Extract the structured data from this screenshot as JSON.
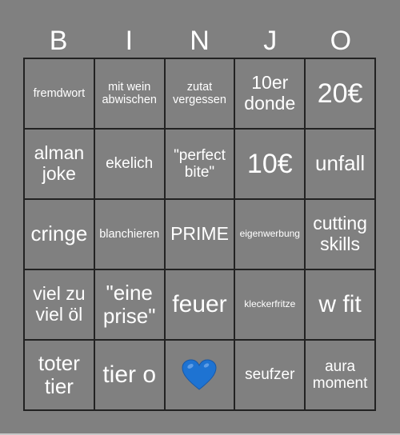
{
  "title_letters": [
    "B",
    "I",
    "N",
    "J",
    "O"
  ],
  "free_space": {
    "icon": "blue-heart-icon",
    "color": "#1e73d2"
  },
  "rows": [
    [
      "fremdwort",
      "mit wein\nabwischen",
      "zutat\nvergessen",
      "10er\ndonde",
      "20€"
    ],
    [
      "alman\njoke",
      "ekelich",
      "\"perfect\nbite\"",
      "10€",
      "unfall"
    ],
    [
      "cringe",
      "blanchieren",
      "PRIME",
      "eigenwerbung",
      "cutting\nskills"
    ],
    [
      "viel zu\nviel öl",
      "\"eine\nprise\"",
      "feuer",
      "kleckerfritze",
      "w fit"
    ],
    [
      "toter\ntier",
      "tier o",
      "",
      "seufzer",
      "aura\nmoment"
    ]
  ]
}
